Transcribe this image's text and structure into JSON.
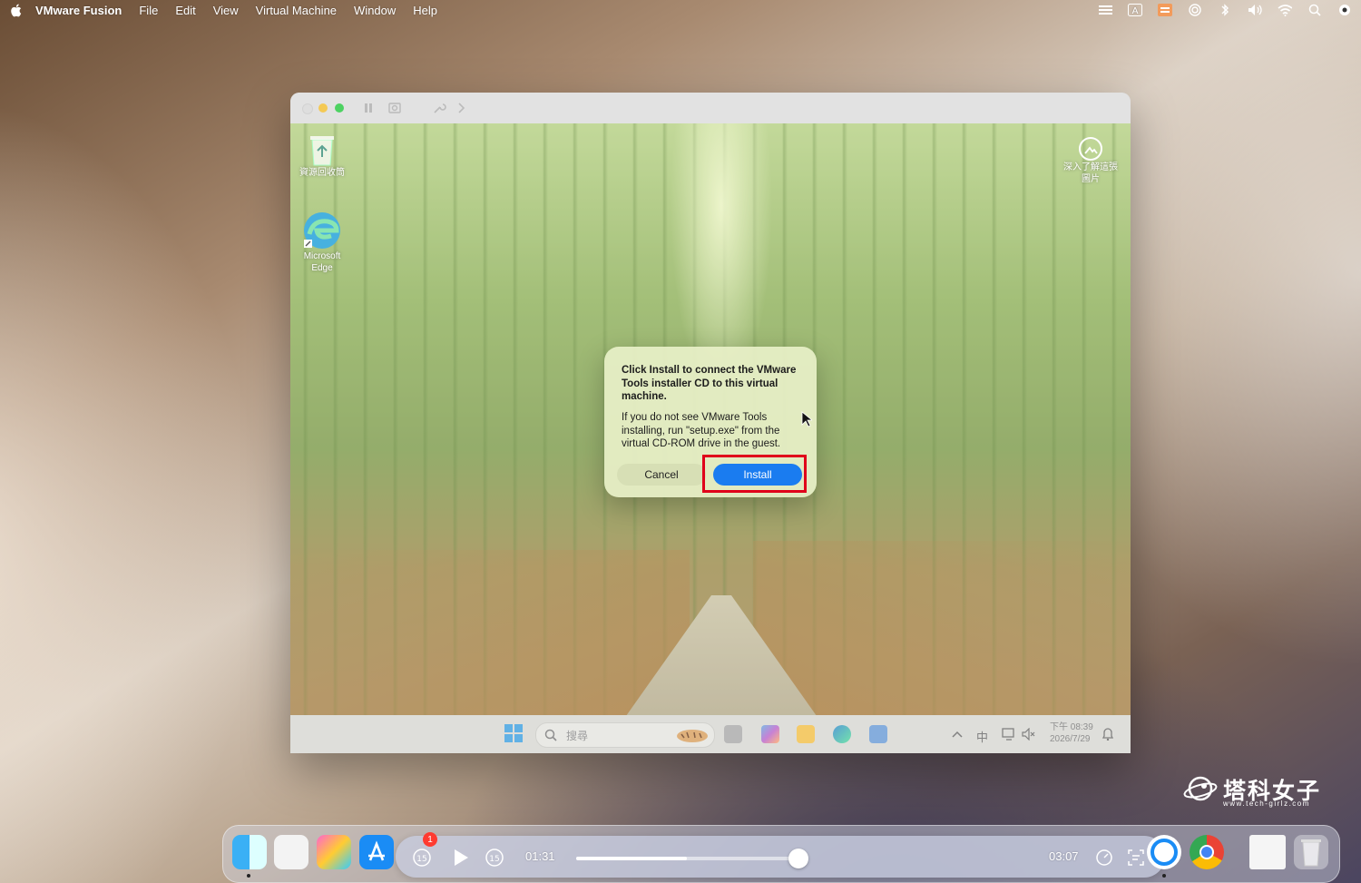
{
  "menubar": {
    "app_name": "VMware Fusion",
    "items": [
      "File",
      "Edit",
      "View",
      "Virtual Machine",
      "Window",
      "Help"
    ]
  },
  "vm_desktop": {
    "icons": [
      {
        "label": "資源回收筒",
        "icon": "recycle-bin-icon"
      },
      {
        "label": "Microsoft Edge",
        "icon": "edge-icon"
      },
      {
        "label": "深入了解這張圖片",
        "icon": "camera-icon"
      }
    ]
  },
  "taskbar": {
    "search_placeholder": "搜尋",
    "ime_label": "中",
    "clock_time": "下午 08:39",
    "clock_date": "2026/7/29"
  },
  "dialog": {
    "title": "Click Install to connect the VMware Tools installer CD to this virtual machine.",
    "body": "If you do not see VMware Tools installing, run \"setup.exe\" from the virtual CD-ROM drive in the guest.",
    "cancel_label": "Cancel",
    "install_label": "Install"
  },
  "watermark": {
    "title": "塔科女子",
    "subtitle": "www.tech-girlz.com"
  },
  "media_controls": {
    "current_time": "01:31",
    "total_time": "03:07",
    "progress": 0.49,
    "skip_back_label": "15",
    "skip_forward_label": "15",
    "notification_badge": "1"
  },
  "colors": {
    "install_button": "#1a7cf0",
    "highlight_box": "#e0001a"
  }
}
